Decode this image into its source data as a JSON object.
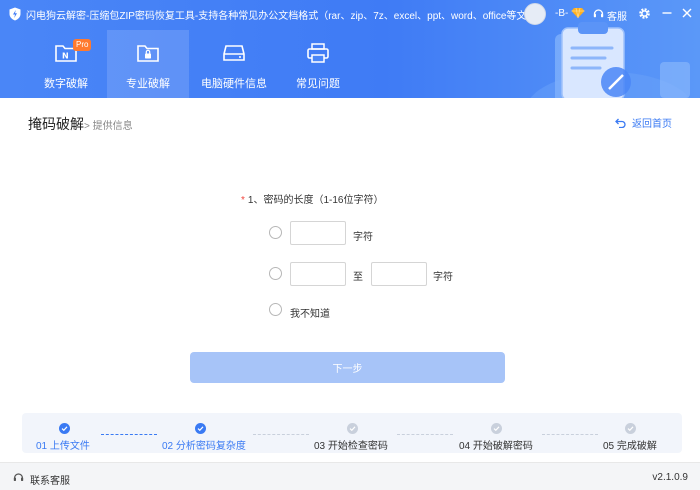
{
  "titlebar": {
    "title": "闪电狗云解密-压缩包ZIP密码恢复工具-支持各种常见办公文档格式（rar、zip、7z、excel、ppt、word、office等文件）",
    "username": "-B-",
    "service_label": "客服"
  },
  "nav": {
    "tabs": [
      {
        "label": "数字破解",
        "badge": "Pro"
      },
      {
        "label": "专业破解"
      },
      {
        "label": "电脑硬件信息"
      },
      {
        "label": "常见问题"
      }
    ]
  },
  "page": {
    "title": "掩码破解",
    "breadcrumb": "> 提供信息",
    "back_label": "返回首页"
  },
  "form": {
    "required_mark": "*",
    "question": "1、密码的长度（1-16位字符）",
    "opt1_unit": "字符",
    "opt2_to": "至",
    "opt2_unit": "字符",
    "opt3_label": "我不知道",
    "next_label": "下一步"
  },
  "steps": [
    {
      "label": "01 上传文件",
      "status": "done"
    },
    {
      "label": "02 分析密码复杂度",
      "status": "done"
    },
    {
      "label": "03 开始检查密码",
      "status": "pending"
    },
    {
      "label": "04 开始破解密码",
      "status": "pending"
    },
    {
      "label": "05 完成破解",
      "status": "pending"
    }
  ],
  "footer": {
    "contact_label": "联系客服",
    "version": "v2.1.0.9"
  },
  "colors": {
    "header": "#4a86f7",
    "accent": "#3a7af3",
    "button_disabled": "#a7c4f8",
    "required": "#f2453d",
    "pro_badge": "#ff7a2f"
  }
}
